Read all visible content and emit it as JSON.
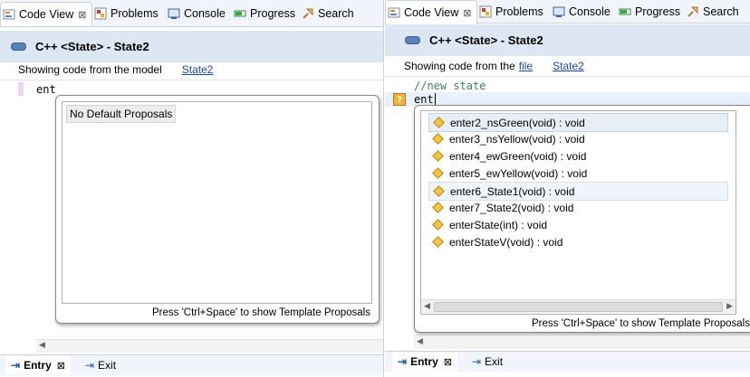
{
  "left": {
    "tabs": [
      {
        "label": "Code View",
        "close": "⊠"
      },
      {
        "label": "Problems"
      },
      {
        "label": "Console"
      },
      {
        "label": "Progress"
      },
      {
        "label": "Search"
      }
    ],
    "title": "C++ <State> - State2",
    "info_prefix": "Showing code from the model",
    "info_link": "State2",
    "code_line": "ent",
    "proposal": "No Default Proposals",
    "status": "Press 'Ctrl+Space' to show Template Proposals",
    "bottom_tabs": [
      {
        "label": "Entry",
        "close": "⊠"
      },
      {
        "label": "Exit"
      }
    ]
  },
  "right": {
    "tabs": [
      {
        "label": "Code View",
        "close": "⊠"
      },
      {
        "label": "Problems"
      },
      {
        "label": "Console"
      },
      {
        "label": "Progress"
      },
      {
        "label": "Search"
      }
    ],
    "title": "C++ <State> - State2",
    "info_prefix": "Showing code from the",
    "info_file_link": "file",
    "info_link": "State2",
    "comment_line": "//new state",
    "code_line": "ent",
    "marker": "?",
    "proposals": [
      "enter2_nsGreen(void) : void",
      "enter3_nsYellow(void) : void",
      "enter4_ewGreen(void) : void",
      "enter5_ewYellow(void) : void",
      "enter6_State1(void) : void",
      "enter7_State2(void) : void",
      "enterState(int) : void",
      "enterStateV(void) : void"
    ],
    "status": "Press 'Ctrl+Space' to show Template Proposals",
    "bottom_tabs": [
      {
        "label": "Entry",
        "close": "⊠"
      },
      {
        "label": "Exit"
      }
    ]
  },
  "colors": {
    "title_bg": "#dde6f3",
    "link": "#1d45a8",
    "comment": "#3f7f5f",
    "proposal_icon": "#f3c34a"
  }
}
